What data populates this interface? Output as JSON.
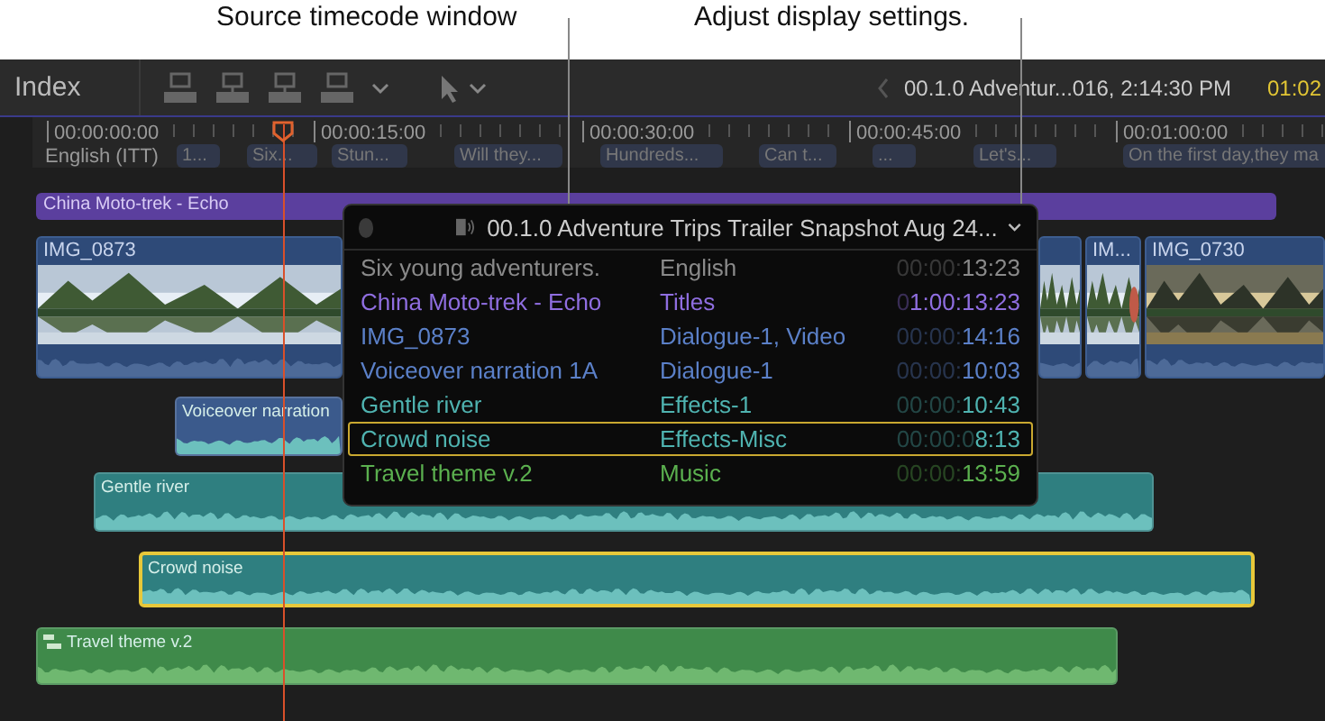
{
  "callouts": [
    {
      "label": "Source timecode window"
    },
    {
      "label": "Adjust display settings."
    }
  ],
  "toolbar": {
    "title": "Index",
    "clip_name": "00.1.0 Adventur...016, 2:14:30 PM",
    "timecode": "01:02"
  },
  "ruler": {
    "ticks": [
      "00:00:00:00",
      "00:00:15:00",
      "00:00:30:00",
      "00:00:45:00",
      "00:01:00:00"
    ]
  },
  "captions": {
    "label": "English (ITT)",
    "chips": [
      "1...",
      "Six...",
      "Stun...",
      "Will they...",
      "Hundreds...",
      "Can t...",
      "...",
      "Let's...",
      "On the first day,they ma"
    ]
  },
  "timeline": {
    "clips": [
      {
        "kind": "title",
        "name": "China Moto-trek - Echo",
        "selected": false
      },
      {
        "kind": "video",
        "name": "IMG_0873",
        "selected": false
      },
      {
        "kind": "video",
        "selected": false
      },
      {
        "kind": "video",
        "name": "IM...",
        "selected": false
      },
      {
        "kind": "video",
        "name": "IMG_0730",
        "selected": false
      },
      {
        "kind": "audio",
        "name": "Voiceover narration",
        "color": "#3b5a8c",
        "selected": false
      },
      {
        "kind": "audio",
        "name": "Gentle river",
        "color": "#2f7f80",
        "selected": false
      },
      {
        "kind": "audio",
        "name": "Crowd noise",
        "color": "#2f7f80",
        "selected": true
      },
      {
        "kind": "storyline",
        "name": "Travel theme v.2",
        "color": "#3f8a4a",
        "selected": false
      }
    ]
  },
  "popup": {
    "title": "00.1.0 Adventure Trips Trailer Snapshot Aug 24...",
    "rows": [
      {
        "name": "Six young adventurers.",
        "role": "English",
        "timecode_lead": "00:00:",
        "timecode": "13:23",
        "color": "#8a8a8a",
        "selected": false
      },
      {
        "name": "China Moto-trek - Echo",
        "role": "Titles",
        "timecode_lead": "0",
        "timecode": "1:00:13:23",
        "color": "#8f6ee0",
        "selected": false
      },
      {
        "name": "IMG_0873",
        "role": "Dialogue-1, Video",
        "timecode_lead": "00:00:",
        "timecode": "14:16",
        "color": "#5b80c8",
        "selected": false
      },
      {
        "name": "Voiceover narration 1A",
        "role": "Dialogue-1",
        "timecode_lead": "00:00:",
        "timecode": "10:03",
        "color": "#5b80c8",
        "selected": false
      },
      {
        "name": "Gentle river",
        "role": "Effects-1",
        "timecode_lead": "00:00:",
        "timecode": "10:43",
        "color": "#4fb3b0",
        "selected": false
      },
      {
        "name": "Crowd noise",
        "role": "Effects-Misc",
        "timecode_lead": "00:00:0",
        "timecode": "8:13",
        "color": "#4fb3b0",
        "selected": true
      },
      {
        "name": "Travel theme v.2",
        "role": "Music",
        "timecode_lead": "00:00:",
        "timecode": "13:59",
        "color": "#5bb04f",
        "selected": false
      }
    ]
  }
}
